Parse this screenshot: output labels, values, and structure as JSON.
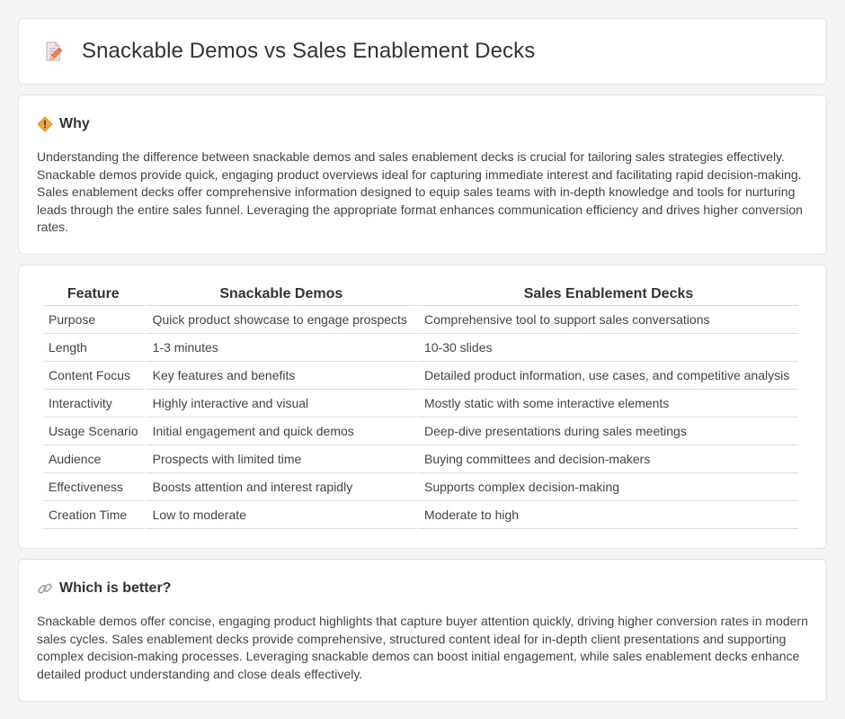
{
  "header": {
    "title": "Snackable Demos vs Sales Enablement Decks",
    "icon": "document-pencil-icon"
  },
  "why": {
    "icon": "diamond-warning-icon",
    "title": "Why",
    "text": "Understanding the difference between snackable demos and sales enablement decks is crucial for tailoring sales strategies effectively. Snackable demos provide quick, engaging product overviews ideal for capturing immediate interest and facilitating rapid decision-making. Sales enablement decks offer comprehensive information designed to equip sales teams with in-depth knowledge and tools for nurturing leads through the entire sales funnel. Leveraging the appropriate format enhances communication efficiency and drives higher conversion rates."
  },
  "table": {
    "headers": [
      "Feature",
      "Snackable Demos",
      "Sales Enablement Decks"
    ],
    "rows": [
      [
        "Purpose",
        "Quick product showcase to engage prospects",
        "Comprehensive tool to support sales conversations"
      ],
      [
        "Length",
        "1-3 minutes",
        "10-30 slides"
      ],
      [
        "Content Focus",
        "Key features and benefits",
        "Detailed product information, use cases, and competitive analysis"
      ],
      [
        "Interactivity",
        "Highly interactive and visual",
        "Mostly static with some interactive elements"
      ],
      [
        "Usage Scenario",
        "Initial engagement and quick demos",
        "Deep-dive presentations during sales meetings"
      ],
      [
        "Audience",
        "Prospects with limited time",
        "Buying committees and decision-makers"
      ],
      [
        "Effectiveness",
        "Boosts attention and interest rapidly",
        "Supports complex decision-making"
      ],
      [
        "Creation Time",
        "Low to moderate",
        "Moderate to high"
      ]
    ]
  },
  "better": {
    "icon": "link-icon",
    "title": "Which is better?",
    "text": "Snackable demos offer concise, engaging product highlights that capture buyer attention quickly, driving higher conversion rates in modern sales cycles. Sales enablement decks provide comprehensive, structured content ideal for in-depth client presentations and supporting complex decision-making processes. Leveraging snackable demos can boost initial engagement, while sales enablement decks enhance detailed product understanding and close deals effectively."
  },
  "colors": {
    "background": "#f4f5f7",
    "card": "#ffffff",
    "border": "#e2e4e8",
    "text": "#444444",
    "heading": "#333333",
    "accent": "#f0a030"
  }
}
